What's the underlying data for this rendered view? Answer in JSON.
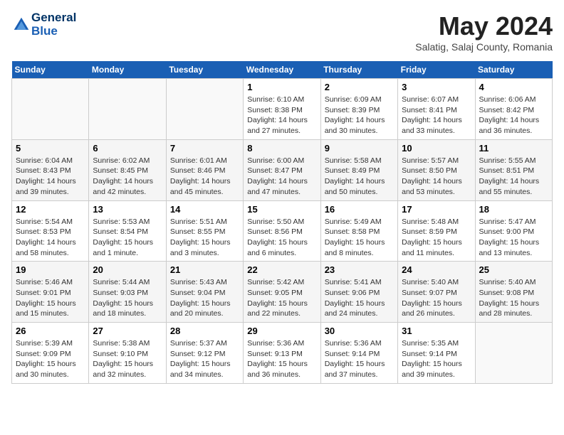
{
  "header": {
    "logo_line1": "General",
    "logo_line2": "Blue",
    "month": "May 2024",
    "location": "Salatig, Salaj County, Romania"
  },
  "weekdays": [
    "Sunday",
    "Monday",
    "Tuesday",
    "Wednesday",
    "Thursday",
    "Friday",
    "Saturday"
  ],
  "weeks": [
    [
      {
        "day": "",
        "info": ""
      },
      {
        "day": "",
        "info": ""
      },
      {
        "day": "",
        "info": ""
      },
      {
        "day": "1",
        "info": "Sunrise: 6:10 AM\nSunset: 8:38 PM\nDaylight: 14 hours\nand 27 minutes."
      },
      {
        "day": "2",
        "info": "Sunrise: 6:09 AM\nSunset: 8:39 PM\nDaylight: 14 hours\nand 30 minutes."
      },
      {
        "day": "3",
        "info": "Sunrise: 6:07 AM\nSunset: 8:41 PM\nDaylight: 14 hours\nand 33 minutes."
      },
      {
        "day": "4",
        "info": "Sunrise: 6:06 AM\nSunset: 8:42 PM\nDaylight: 14 hours\nand 36 minutes."
      }
    ],
    [
      {
        "day": "5",
        "info": "Sunrise: 6:04 AM\nSunset: 8:43 PM\nDaylight: 14 hours\nand 39 minutes."
      },
      {
        "day": "6",
        "info": "Sunrise: 6:02 AM\nSunset: 8:45 PM\nDaylight: 14 hours\nand 42 minutes."
      },
      {
        "day": "7",
        "info": "Sunrise: 6:01 AM\nSunset: 8:46 PM\nDaylight: 14 hours\nand 45 minutes."
      },
      {
        "day": "8",
        "info": "Sunrise: 6:00 AM\nSunset: 8:47 PM\nDaylight: 14 hours\nand 47 minutes."
      },
      {
        "day": "9",
        "info": "Sunrise: 5:58 AM\nSunset: 8:49 PM\nDaylight: 14 hours\nand 50 minutes."
      },
      {
        "day": "10",
        "info": "Sunrise: 5:57 AM\nSunset: 8:50 PM\nDaylight: 14 hours\nand 53 minutes."
      },
      {
        "day": "11",
        "info": "Sunrise: 5:55 AM\nSunset: 8:51 PM\nDaylight: 14 hours\nand 55 minutes."
      }
    ],
    [
      {
        "day": "12",
        "info": "Sunrise: 5:54 AM\nSunset: 8:53 PM\nDaylight: 14 hours\nand 58 minutes."
      },
      {
        "day": "13",
        "info": "Sunrise: 5:53 AM\nSunset: 8:54 PM\nDaylight: 15 hours\nand 1 minute."
      },
      {
        "day": "14",
        "info": "Sunrise: 5:51 AM\nSunset: 8:55 PM\nDaylight: 15 hours\nand 3 minutes."
      },
      {
        "day": "15",
        "info": "Sunrise: 5:50 AM\nSunset: 8:56 PM\nDaylight: 15 hours\nand 6 minutes."
      },
      {
        "day": "16",
        "info": "Sunrise: 5:49 AM\nSunset: 8:58 PM\nDaylight: 15 hours\nand 8 minutes."
      },
      {
        "day": "17",
        "info": "Sunrise: 5:48 AM\nSunset: 8:59 PM\nDaylight: 15 hours\nand 11 minutes."
      },
      {
        "day": "18",
        "info": "Sunrise: 5:47 AM\nSunset: 9:00 PM\nDaylight: 15 hours\nand 13 minutes."
      }
    ],
    [
      {
        "day": "19",
        "info": "Sunrise: 5:46 AM\nSunset: 9:01 PM\nDaylight: 15 hours\nand 15 minutes."
      },
      {
        "day": "20",
        "info": "Sunrise: 5:44 AM\nSunset: 9:03 PM\nDaylight: 15 hours\nand 18 minutes."
      },
      {
        "day": "21",
        "info": "Sunrise: 5:43 AM\nSunset: 9:04 PM\nDaylight: 15 hours\nand 20 minutes."
      },
      {
        "day": "22",
        "info": "Sunrise: 5:42 AM\nSunset: 9:05 PM\nDaylight: 15 hours\nand 22 minutes."
      },
      {
        "day": "23",
        "info": "Sunrise: 5:41 AM\nSunset: 9:06 PM\nDaylight: 15 hours\nand 24 minutes."
      },
      {
        "day": "24",
        "info": "Sunrise: 5:40 AM\nSunset: 9:07 PM\nDaylight: 15 hours\nand 26 minutes."
      },
      {
        "day": "25",
        "info": "Sunrise: 5:40 AM\nSunset: 9:08 PM\nDaylight: 15 hours\nand 28 minutes."
      }
    ],
    [
      {
        "day": "26",
        "info": "Sunrise: 5:39 AM\nSunset: 9:09 PM\nDaylight: 15 hours\nand 30 minutes."
      },
      {
        "day": "27",
        "info": "Sunrise: 5:38 AM\nSunset: 9:10 PM\nDaylight: 15 hours\nand 32 minutes."
      },
      {
        "day": "28",
        "info": "Sunrise: 5:37 AM\nSunset: 9:12 PM\nDaylight: 15 hours\nand 34 minutes."
      },
      {
        "day": "29",
        "info": "Sunrise: 5:36 AM\nSunset: 9:13 PM\nDaylight: 15 hours\nand 36 minutes."
      },
      {
        "day": "30",
        "info": "Sunrise: 5:36 AM\nSunset: 9:14 PM\nDaylight: 15 hours\nand 37 minutes."
      },
      {
        "day": "31",
        "info": "Sunrise: 5:35 AM\nSunset: 9:14 PM\nDaylight: 15 hours\nand 39 minutes."
      },
      {
        "day": "",
        "info": ""
      }
    ]
  ]
}
